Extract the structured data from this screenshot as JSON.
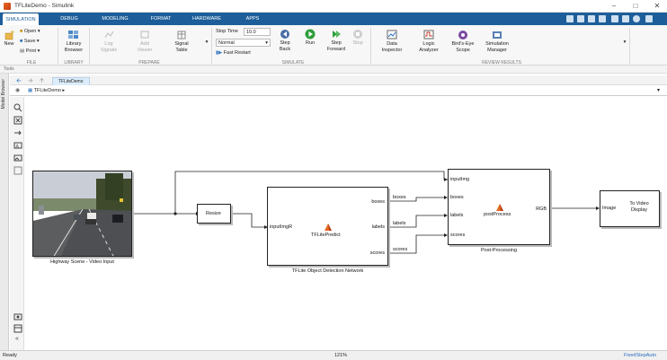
{
  "window": {
    "title": "TFLiteDemo - Simulink"
  },
  "tabs": [
    {
      "label": "SIMULATION",
      "active": true
    },
    {
      "label": "DEBUG"
    },
    {
      "label": "MODELING"
    },
    {
      "label": "FORMAT"
    },
    {
      "label": "HARDWARE"
    },
    {
      "label": "APPS"
    }
  ],
  "ribbon": {
    "file": {
      "new": "New",
      "open": "Open",
      "save": "Save",
      "print": "Print",
      "group": "FILE"
    },
    "library": {
      "browser": "Library Browser",
      "group": "LIBRARY"
    },
    "prepare": {
      "log_signals": "Log Signals",
      "add_viewer": "Add Viewer",
      "signal_table": "Signal Table",
      "group": "PREPARE"
    },
    "simulate": {
      "stop_time_label": "Stop Time",
      "stop_time": "10.0",
      "mode": "Normal",
      "fast_restart": "Fast Restart",
      "step_back": "Step Back",
      "run": "Run",
      "step_forward": "Step Forward",
      "stop": "Stop",
      "group": "SIMULATE"
    },
    "review": {
      "data_inspector": "Data Inspector",
      "logic_analyzer": "Logic Analyzer",
      "birds_eye": "Bird's-Eye Scope",
      "sim_manager": "Simulation Manager",
      "group": "REVIEW RESULTS"
    }
  },
  "tools_label": "Tools",
  "model_browser_label": "Model Browser",
  "doc_tab": "TFLiteDemo",
  "breadcrumb": "TFLiteDemo",
  "diagram": {
    "video_caption": "Highway Scene - Video Input",
    "resize": "Resize",
    "detect": {
      "name": "TFLitePredict",
      "caption": "TFLite Object Detection Network",
      "in": "inputImgR",
      "out_boxes": "boxes",
      "out_labels": "labels",
      "out_scores": "scores"
    },
    "post": {
      "name": "postProcess",
      "caption": "Post-Processing",
      "in_img": "inputImg",
      "in_boxes": "boxes",
      "in_labels": "labels",
      "in_scores": "scores",
      "out": "RGB"
    },
    "sig_boxes": "boxes",
    "sig_labels": "labels",
    "sig_scores": "scores",
    "display": {
      "in": "Image",
      "title": "To Video Display"
    }
  },
  "status": {
    "left": "Ready",
    "zoom": "121%",
    "solver": "FixedStepAuto"
  },
  "colors": {
    "tab_bar": "#1d5e9a",
    "accent": "#2a6ebb"
  }
}
